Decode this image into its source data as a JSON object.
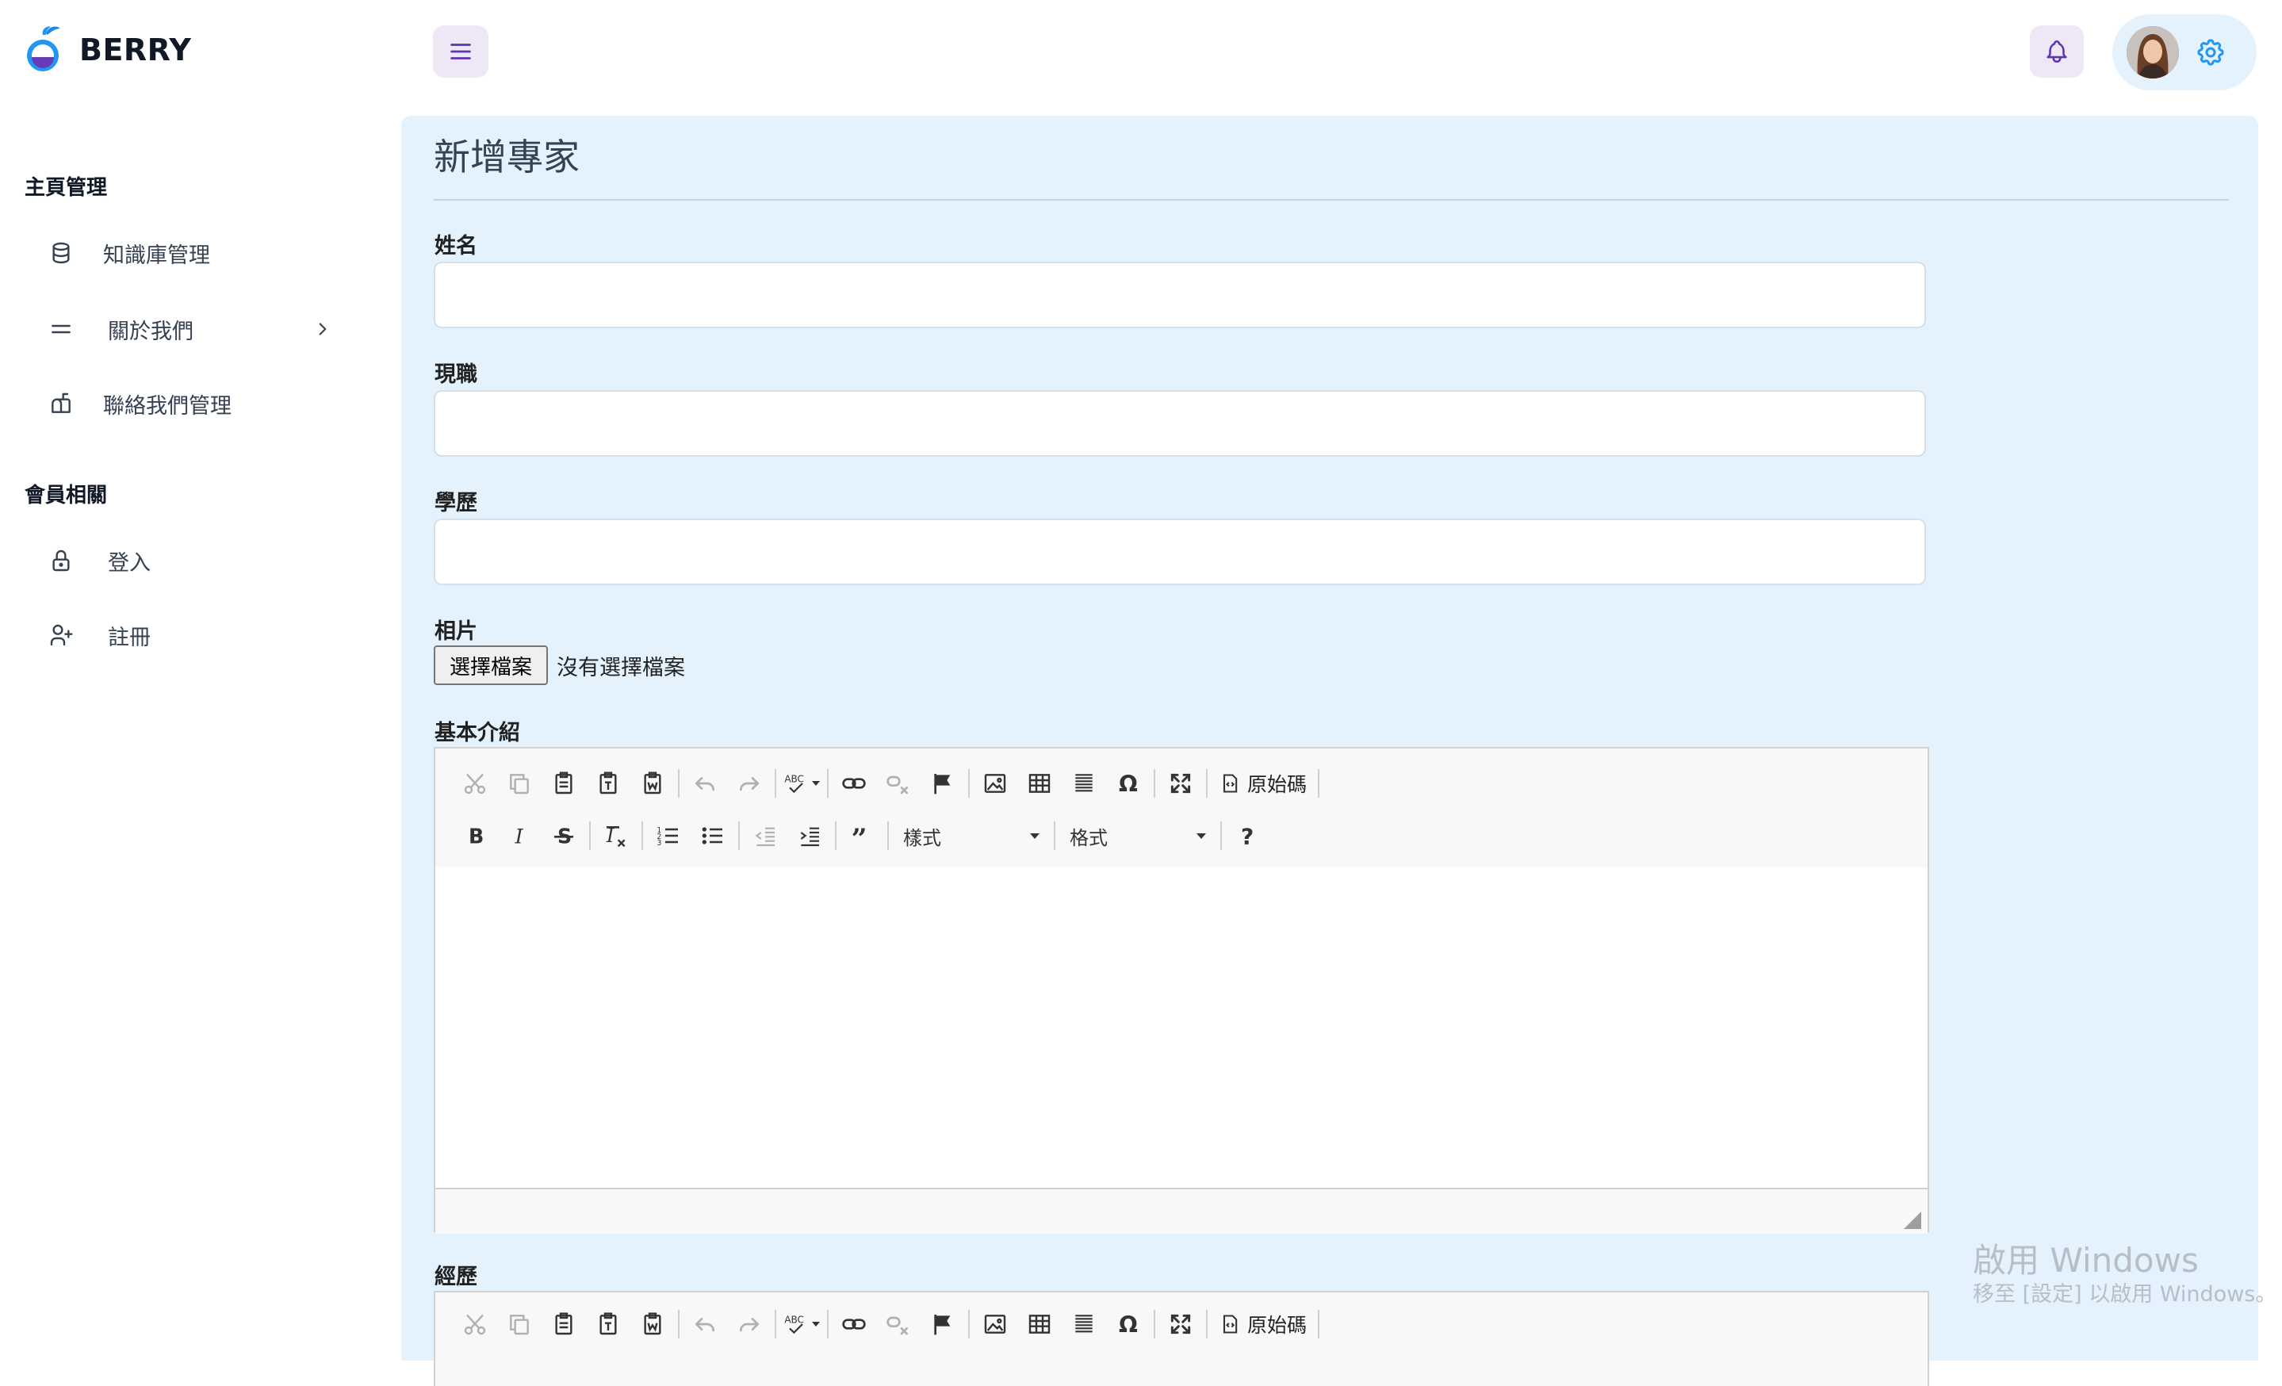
{
  "app": {
    "brand": "BERRY"
  },
  "sidebar": {
    "groups": [
      {
        "title": "主頁管理"
      },
      {
        "title": "會員相關"
      }
    ],
    "items": [
      {
        "label": "知識庫管理",
        "icon": "database-icon"
      },
      {
        "label": "關於我們",
        "icon": "menu-lines-icon"
      },
      {
        "label": "聯絡我們管理",
        "icon": "mailbox-icon"
      },
      {
        "label": "登入",
        "icon": "lock-icon"
      },
      {
        "label": "註冊",
        "icon": "user-plus-icon"
      }
    ]
  },
  "header": {
    "menu_icon": "hamburger-icon",
    "notification_icon": "bell-icon",
    "settings_icon": "gear-icon",
    "accent": "#673ab7",
    "secondary": "#2196f3"
  },
  "form": {
    "title": "新增專家",
    "fields": {
      "name": {
        "label": "姓名",
        "value": ""
      },
      "position": {
        "label": "現職",
        "value": ""
      },
      "education": {
        "label": "學歷",
        "value": ""
      },
      "photo": {
        "label": "相片",
        "button": "選擇檔案",
        "status": "沒有選擇檔案"
      },
      "intro": {
        "label": "基本介紹"
      },
      "experience": {
        "label": "經歷"
      }
    }
  },
  "editor": {
    "source_button": "原始碼",
    "styles_combo": "樣式",
    "format_combo": "格式"
  },
  "watermark": {
    "title": "啟用 Windows",
    "subtitle": "移至 [設定] 以啟用 Windows。"
  }
}
